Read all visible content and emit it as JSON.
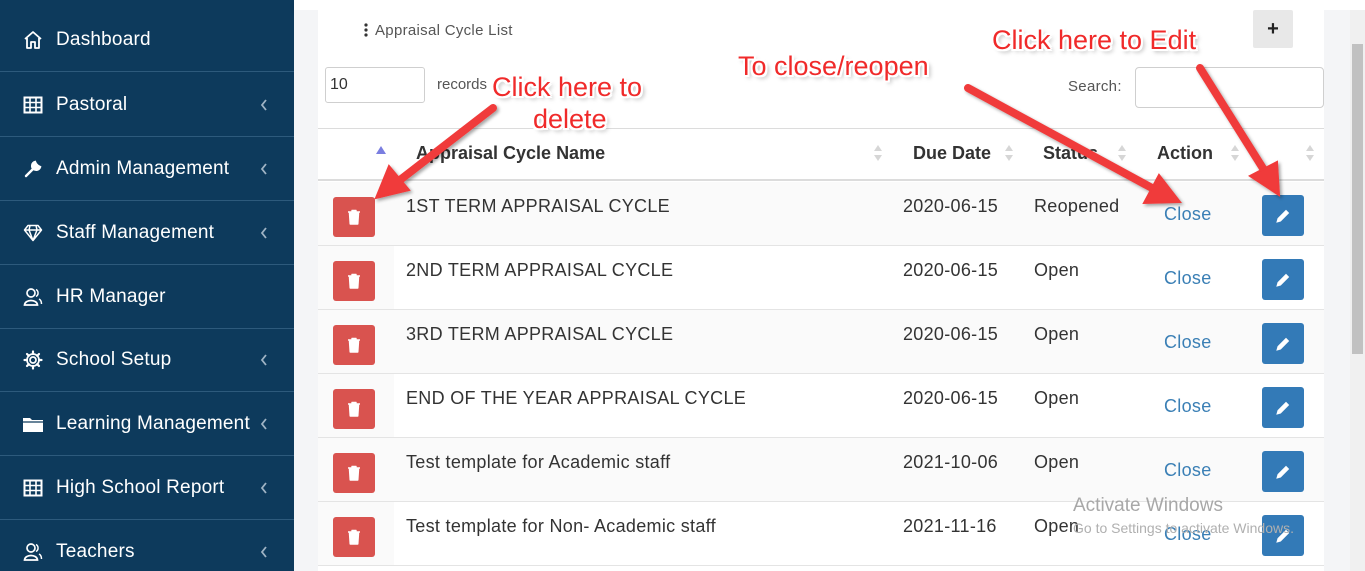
{
  "sidebar": {
    "items": [
      {
        "label": "Dashboard",
        "icon": "home-icon",
        "has_chevron": false
      },
      {
        "label": "Pastoral",
        "icon": "table-icon",
        "has_chevron": true
      },
      {
        "label": "Admin Management",
        "icon": "wrench-icon",
        "has_chevron": true
      },
      {
        "label": "Staff Management",
        "icon": "diamond-icon",
        "has_chevron": true
      },
      {
        "label": "HR Manager",
        "icon": "users-icon",
        "has_chevron": false
      },
      {
        "label": "School Setup",
        "icon": "gear-icon",
        "has_chevron": true
      },
      {
        "label": "Learning Management",
        "icon": "folder-icon",
        "has_chevron": true
      },
      {
        "label": "High School Report",
        "icon": "table-icon",
        "has_chevron": true
      },
      {
        "label": "Teachers",
        "icon": "users-icon",
        "has_chevron": true
      }
    ]
  },
  "card": {
    "title": "Appraisal Cycle List",
    "add_label": "+"
  },
  "controls": {
    "page_length": "10",
    "records_label": "records",
    "search_label": "Search:"
  },
  "table": {
    "headers": {
      "name": "Appraisal Cycle Name",
      "due_date": "Due Date",
      "status": "Status",
      "action": "Action"
    },
    "rows": [
      {
        "name": "1ST TERM APPRAISAL CYCLE",
        "due_date": "2020-06-15",
        "status": "Reopened",
        "action": "Close"
      },
      {
        "name": "2ND TERM APPRAISAL CYCLE",
        "due_date": "2020-06-15",
        "status": "Open",
        "action": "Close"
      },
      {
        "name": "3RD TERM APPRAISAL CYCLE",
        "due_date": "2020-06-15",
        "status": "Open",
        "action": "Close"
      },
      {
        "name": "END OF THE YEAR APPRAISAL CYCLE",
        "due_date": "2020-06-15",
        "status": "Open",
        "action": "Close"
      },
      {
        "name": "Test template for Academic staff",
        "due_date": "2021-10-06",
        "status": "Open",
        "action": "Close"
      },
      {
        "name": "Test template for Non- Academic staff",
        "due_date": "2021-11-16",
        "status": "Open",
        "action": "Close"
      }
    ]
  },
  "annotations": {
    "delete_line1": "Click here to",
    "delete_line2": "delete",
    "close_reopen": "To close/reopen",
    "edit": "Click here to Edit"
  },
  "watermark": {
    "line1": "Activate Windows",
    "line2": "Go to Settings to activate Windows."
  },
  "colors": {
    "sidebar_bg": "#0d3a5c",
    "delete_button": "#d9534f",
    "edit_button": "#337ab7",
    "link": "#3a7fb5",
    "annotation": "#f02a2a"
  }
}
